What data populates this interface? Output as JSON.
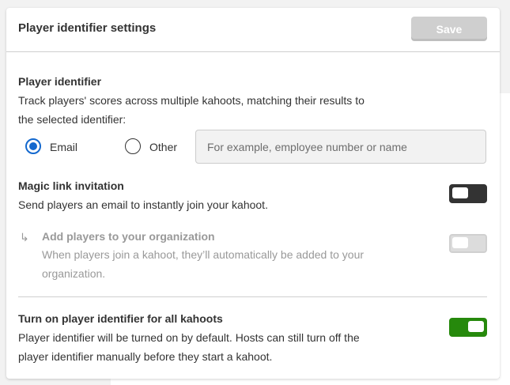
{
  "header": {
    "title": "Player identifier settings",
    "save_label": "Save"
  },
  "player_identifier": {
    "title": "Player identifier",
    "description_line1": "Track players' scores across multiple kahoots, matching their results to",
    "description_line2": "the selected identifier:",
    "options": [
      {
        "label": "Email",
        "checked": true
      },
      {
        "label": "Other",
        "checked": false
      }
    ],
    "other_input": {
      "value": "",
      "placeholder": "For example, employee number or name"
    }
  },
  "magic_link": {
    "title": "Magic link invitation",
    "description": "Send players an email to instantly join your kahoot.",
    "toggle_on": false
  },
  "add_to_org": {
    "title": "Add players to your organization",
    "description_line1": "When players join a kahoot, they’ll automatically be added to your",
    "description_line2": "organization.",
    "toggle_on": false,
    "disabled": true,
    "icon": "subdirectory-arrow-icon"
  },
  "all_kahoots": {
    "title": "Turn on player identifier for all kahoots",
    "description_line1": "Player identifier will be turned on by default. Hosts can still turn off the",
    "description_line2": "player identifier manually before they start a kahoot.",
    "toggle_on": true
  },
  "colors": {
    "accent_blue": "#1368ce",
    "toggle_on_green": "#26890c",
    "toggle_off_dark": "#333333",
    "disabled_gray": "#cfcfcf"
  }
}
